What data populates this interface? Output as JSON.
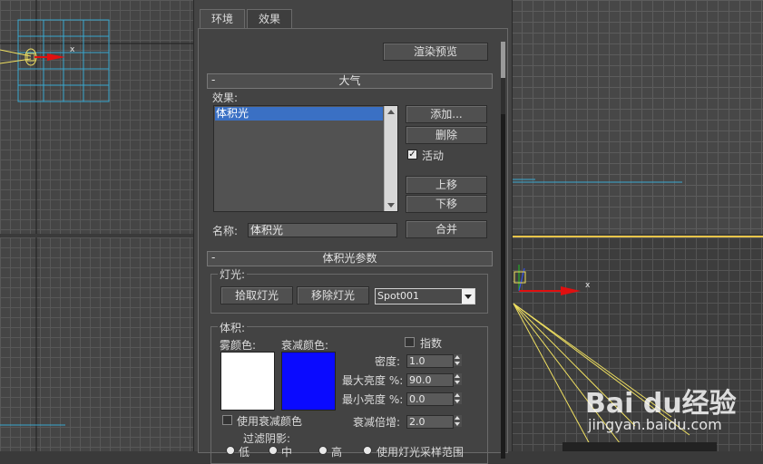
{
  "tabs": [
    {
      "label": "环境",
      "active": true
    },
    {
      "label": "效果",
      "active": false
    }
  ],
  "render_preview_label": "渲染预览",
  "atmosphere": {
    "rollout_minus": "-",
    "title": "大气",
    "effects_label": "效果:",
    "effects_list": [
      "体积光"
    ],
    "add_label": "添加...",
    "delete_label": "删除",
    "active_label": "活动",
    "active_checked": true,
    "move_up_label": "上移",
    "move_down_label": "下移",
    "name_label": "名称:",
    "name_value": "体积光",
    "merge_label": "合并"
  },
  "volume_light": {
    "rollout_minus": "-",
    "title": "体积光参数",
    "lights_group_label": "灯光:",
    "pick_light_label": "拾取灯光",
    "remove_light_label": "移除灯光",
    "light_selected": "Spot001",
    "volume_group_label": "体积:",
    "fog_color_label": "雾颜色:",
    "atten_color_label": "衰减颜色:",
    "fog_color": "#ffffff",
    "atten_color": "#0a0aff",
    "exponential_label": "指数",
    "exponential_checked": false,
    "density_label": "密度:",
    "density_value": "1.0",
    "max_brightness_label": "最大亮度 %:",
    "max_brightness_value": "90.0",
    "min_brightness_label": "最小亮度 %:",
    "min_brightness_value": "0.0",
    "use_atten_color_label": "使用衰减颜色",
    "use_atten_color_checked": false,
    "atten_multiplier_label": "衰减倍增:",
    "atten_multiplier_value": "2.0",
    "filter_shadows_label": "过滤阴影:",
    "shadow_options": [
      "低",
      "中",
      "高",
      "使用灯光采样范围"
    ]
  },
  "viewport": {
    "axis_x_label": "x"
  },
  "watermark": {
    "main": "Bai du经验",
    "sub": "jingyan.baidu.com"
  },
  "colors": {
    "selection": "#3a70c4",
    "viewport_border": "#e8c44a",
    "axis_x": "#e01010",
    "light_cone": "#f0e060",
    "top_view_grid": "#38a8d0"
  }
}
